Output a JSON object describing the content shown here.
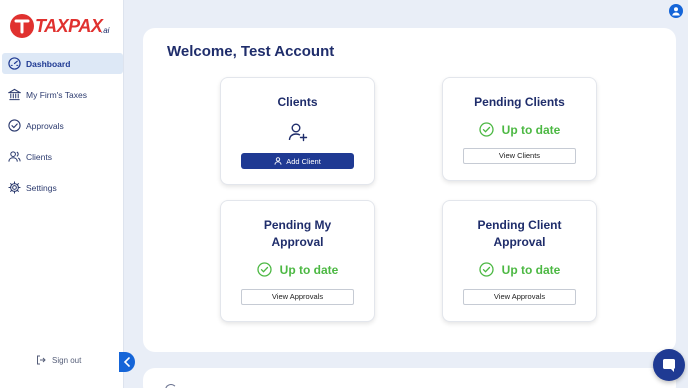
{
  "brand": {
    "name": "TAXPAX",
    "suffix": ".ai"
  },
  "sidebar": {
    "items": [
      {
        "label": "Dashboard",
        "icon": "dashboard-gauge-icon",
        "active": true
      },
      {
        "label": "My Firm's Taxes",
        "icon": "bank-building-icon",
        "active": false
      },
      {
        "label": "Approvals",
        "icon": "check-circle-icon",
        "active": false
      },
      {
        "label": "Clients",
        "icon": "users-icon",
        "active": false
      },
      {
        "label": "Settings",
        "icon": "gear-icon",
        "active": false
      }
    ],
    "signout_label": "Sign out"
  },
  "main": {
    "welcome": "Welcome, Test Account",
    "cards": {
      "clients": {
        "title": "Clients",
        "button": "Add Client",
        "icon": "add-user-icon"
      },
      "pending_clients": {
        "title": "Pending Clients",
        "status": "Up to date",
        "button": "View Clients"
      },
      "pending_my_approval": {
        "title_line1": "Pending My",
        "title_line2": "Approval",
        "status": "Up to date",
        "button": "View Approvals"
      },
      "pending_client_approval": {
        "title_line1": "Pending Client",
        "title_line2": "Approval",
        "status": "Up to date",
        "button": "View Approvals"
      }
    }
  },
  "colors": {
    "accent": "#1f3a93",
    "brand_red": "#e0312f",
    "success": "#4cb843",
    "link_blue": "#1565d8"
  }
}
